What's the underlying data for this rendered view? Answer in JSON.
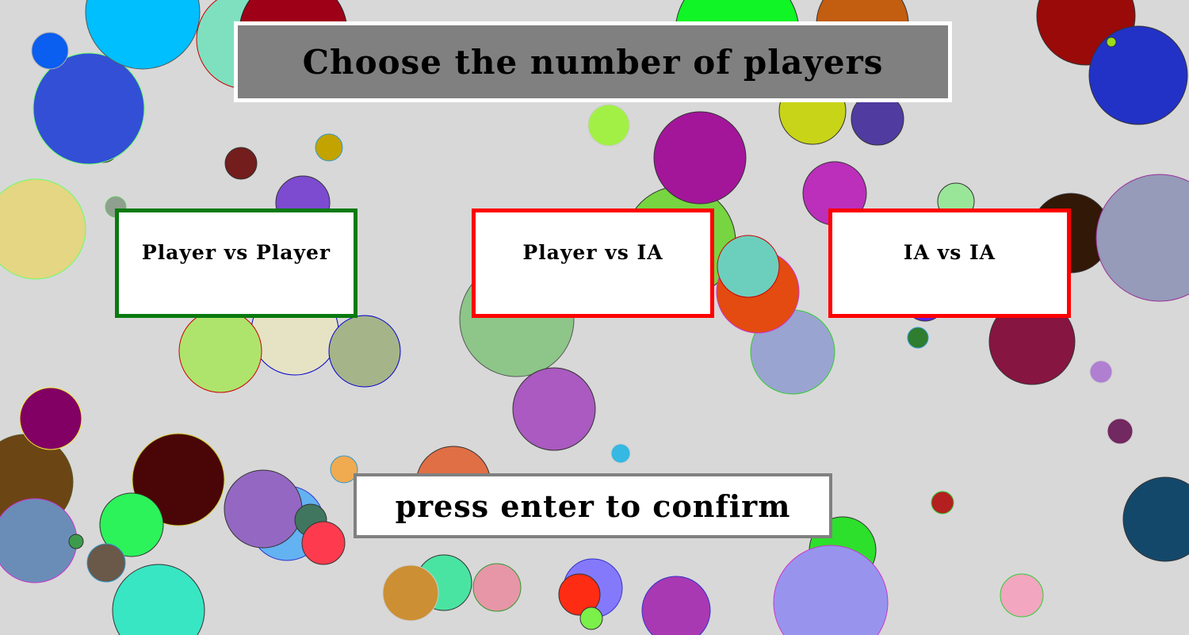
{
  "title": "Choose the number of players",
  "options": [
    {
      "label": "Player vs Player",
      "selected": true
    },
    {
      "label": "Player vs IA",
      "selected": false
    },
    {
      "label": "IA vs IA",
      "selected": false
    }
  ],
  "confirm_hint": "press enter to confirm",
  "colors": {
    "background": "#d8d8d8",
    "title_box": "#808080",
    "selected_border": "#0a7a10",
    "unselected_border": "#ff0000",
    "confirm_border": "#808080"
  }
}
